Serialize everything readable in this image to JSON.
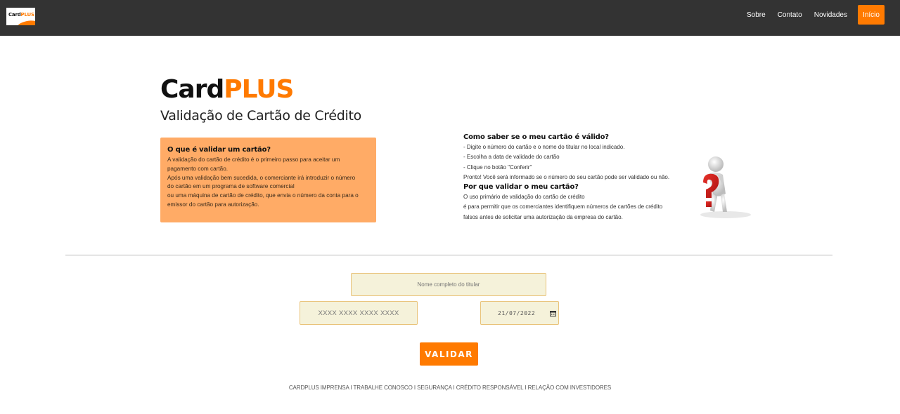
{
  "navbar": {
    "logo": {
      "part1": "Card",
      "part2": "PLUS"
    },
    "links": [
      {
        "label": "Sobre"
      },
      {
        "label": "Contato"
      },
      {
        "label": "Novidades"
      },
      {
        "label": "Início"
      }
    ]
  },
  "brand": {
    "part1": "Card",
    "part2": "PLUS"
  },
  "subtitle": "Validação de Cartão de Crédito",
  "info_box": {
    "title": "O que é validar um cartão?",
    "lines": [
      "A validação do cartão de crédito é o primeiro passo para aceitar um",
      "pagamento com cartão.",
      "Após uma validação bem sucedida, o comerciante irá introduzir o número",
      "do cartão em um programa de software comercial",
      "ou uma máquina de cartão de crédito, que envia o número da conta para o",
      "emissor do cartão para autorização."
    ]
  },
  "faq": {
    "q1": "Como saber se o meu cartão é válido?",
    "a1": [
      "- Digite o número do cartão e o nome do titular no    local indicado.",
      "- Escolha a data de validade do cartão",
      "- Clique no botão \"Conferir\"",
      "Pronto! Você será informado se o número do seu cartão pode ser validado ou não."
    ],
    "q2": "Por que validar o meu cartão?",
    "a2": [
      "O uso primário de validação do cartão de crédito",
      "é para permitir que os comerciantes identifiquem números de cartões de crédito",
      "falsos antes de solicitar uma autorização da empresa do cartão."
    ]
  },
  "form": {
    "name_placeholder": "Nome completo do titular",
    "card_placeholder": "XXXX XXXX XXXX XXXX",
    "date_value": "21/07/2022",
    "submit_label": "VALIDAR"
  },
  "footer": "CARDPLUS IMPRENSA I TRABALHE CONOSCO I SEGURANÇA I CRÉDITO RESPONSÁVEL I RELAÇÃO COM INVESTIDORES",
  "colors": {
    "accent": "#ff7a00",
    "navbar": "#333333",
    "info_box": "#ffab66",
    "field_bg": "#f5f2da"
  }
}
